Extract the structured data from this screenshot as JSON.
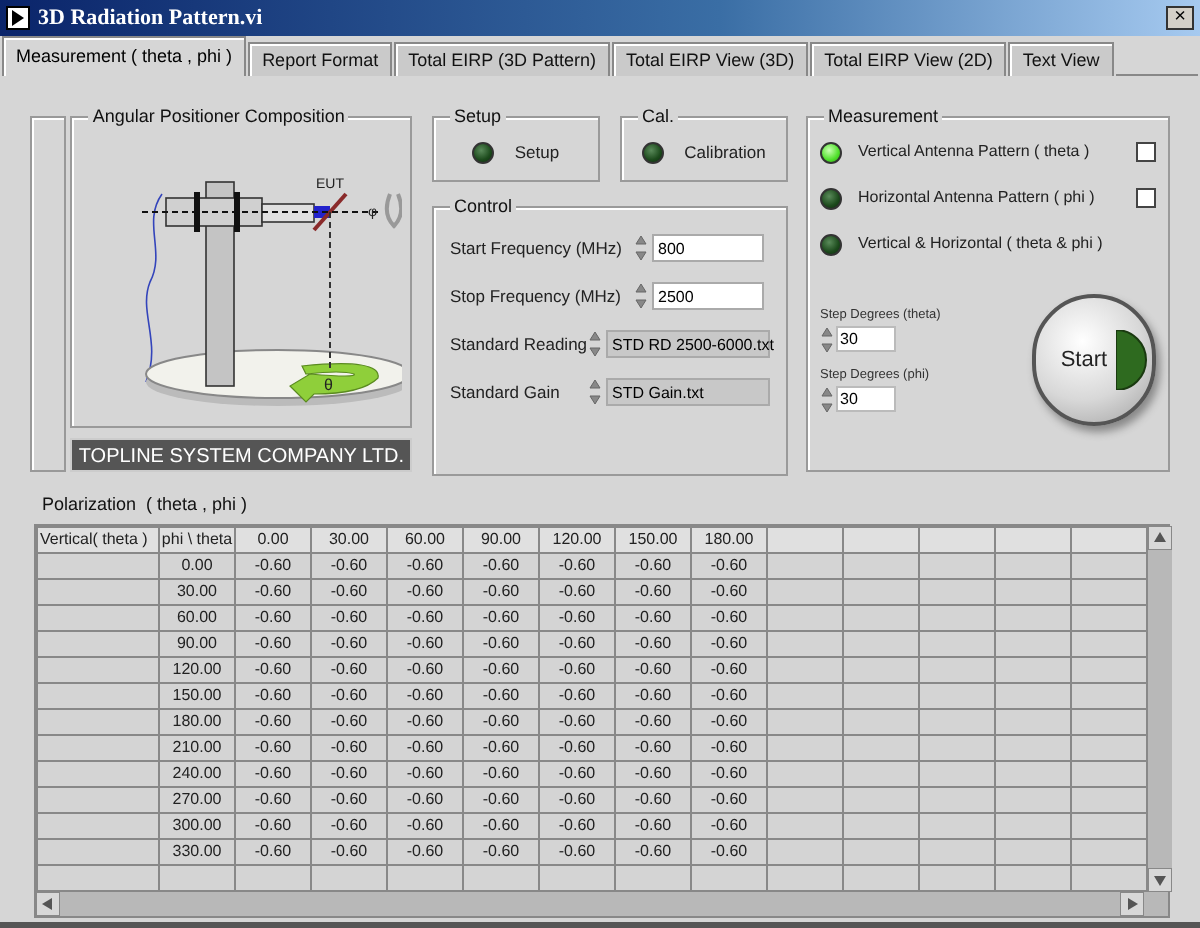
{
  "window": {
    "title": "3D Radiation Pattern.vi",
    "close": "×"
  },
  "tabs": [
    {
      "label": "Measurement ( theta , phi )",
      "selected": true
    },
    {
      "label": "Report Format",
      "selected": false
    },
    {
      "label": "Total EIRP (3D Pattern)",
      "selected": false
    },
    {
      "label": "Total EIRP View (3D)",
      "selected": false
    },
    {
      "label": "Total EIRP View (2D)",
      "selected": false
    },
    {
      "label": "Text View",
      "selected": false
    }
  ],
  "positioner": {
    "title": "Angular Positioner Composition",
    "eut_label": "EUT",
    "phi_label": "φ",
    "theta_label": "θ",
    "company": "TOPLINE SYSTEM COMPANY LTD."
  },
  "setup": {
    "title": "Setup",
    "led_on": false,
    "label": "Setup"
  },
  "cal": {
    "title": "Cal.",
    "led_on": false,
    "label": "Calibration"
  },
  "control": {
    "title": "Control",
    "fields": [
      {
        "label": "Start Frequency (MHz)",
        "value": "800",
        "kind": "numeric"
      },
      {
        "label": "Stop Frequency (MHz)",
        "value": "2500",
        "kind": "numeric"
      },
      {
        "label": "Standard Reading",
        "value": "STD RD 2500-6000.txt",
        "kind": "file"
      },
      {
        "label": "Standard Gain",
        "value": "STD Gain.txt",
        "kind": "file"
      }
    ]
  },
  "measurement": {
    "title": "Measurement",
    "modes": [
      {
        "label": "Vertical Antenna Pattern ( theta )",
        "led_on": true,
        "kind": "checkbox",
        "checked": false
      },
      {
        "label": "Horizontal Antenna Pattern ( phi )",
        "led_on": false,
        "kind": "checkbox",
        "checked": false
      },
      {
        "label": "Vertical & Horizontal ( theta & phi )",
        "led_on": false,
        "kind": "plain"
      }
    ],
    "steps": [
      {
        "label": "Step Degrees (theta)",
        "value": "30"
      },
      {
        "label": "Step Degrees (phi)",
        "value": "30"
      }
    ],
    "start_button": "Start"
  },
  "table": {
    "title": "Polarization  ( theta , phi )",
    "columns": [
      "Vertical( theta )",
      "phi \\ theta",
      "0.00",
      "30.00",
      "60.00",
      "90.00",
      "120.00",
      "150.00",
      "180.00"
    ],
    "rows": [
      {
        "phi": "0.00",
        "values": [
          "-0.60",
          "-0.60",
          "-0.60",
          "-0.60",
          "-0.60",
          "-0.60",
          "-0.60"
        ]
      },
      {
        "phi": "30.00",
        "values": [
          "-0.60",
          "-0.60",
          "-0.60",
          "-0.60",
          "-0.60",
          "-0.60",
          "-0.60"
        ]
      },
      {
        "phi": "60.00",
        "values": [
          "-0.60",
          "-0.60",
          "-0.60",
          "-0.60",
          "-0.60",
          "-0.60",
          "-0.60"
        ]
      },
      {
        "phi": "90.00",
        "values": [
          "-0.60",
          "-0.60",
          "-0.60",
          "-0.60",
          "-0.60",
          "-0.60",
          "-0.60"
        ]
      },
      {
        "phi": "120.00",
        "values": [
          "-0.60",
          "-0.60",
          "-0.60",
          "-0.60",
          "-0.60",
          "-0.60",
          "-0.60"
        ]
      },
      {
        "phi": "150.00",
        "values": [
          "-0.60",
          "-0.60",
          "-0.60",
          "-0.60",
          "-0.60",
          "-0.60",
          "-0.60"
        ]
      },
      {
        "phi": "180.00",
        "values": [
          "-0.60",
          "-0.60",
          "-0.60",
          "-0.60",
          "-0.60",
          "-0.60",
          "-0.60"
        ]
      },
      {
        "phi": "210.00",
        "values": [
          "-0.60",
          "-0.60",
          "-0.60",
          "-0.60",
          "-0.60",
          "-0.60",
          "-0.60"
        ]
      },
      {
        "phi": "240.00",
        "values": [
          "-0.60",
          "-0.60",
          "-0.60",
          "-0.60",
          "-0.60",
          "-0.60",
          "-0.60"
        ]
      },
      {
        "phi": "270.00",
        "values": [
          "-0.60",
          "-0.60",
          "-0.60",
          "-0.60",
          "-0.60",
          "-0.60",
          "-0.60"
        ]
      },
      {
        "phi": "300.00",
        "values": [
          "-0.60",
          "-0.60",
          "-0.60",
          "-0.60",
          "-0.60",
          "-0.60",
          "-0.60"
        ]
      },
      {
        "phi": "330.00",
        "values": [
          "-0.60",
          "-0.60",
          "-0.60",
          "-0.60",
          "-0.60",
          "-0.60",
          "-0.60"
        ]
      }
    ]
  }
}
